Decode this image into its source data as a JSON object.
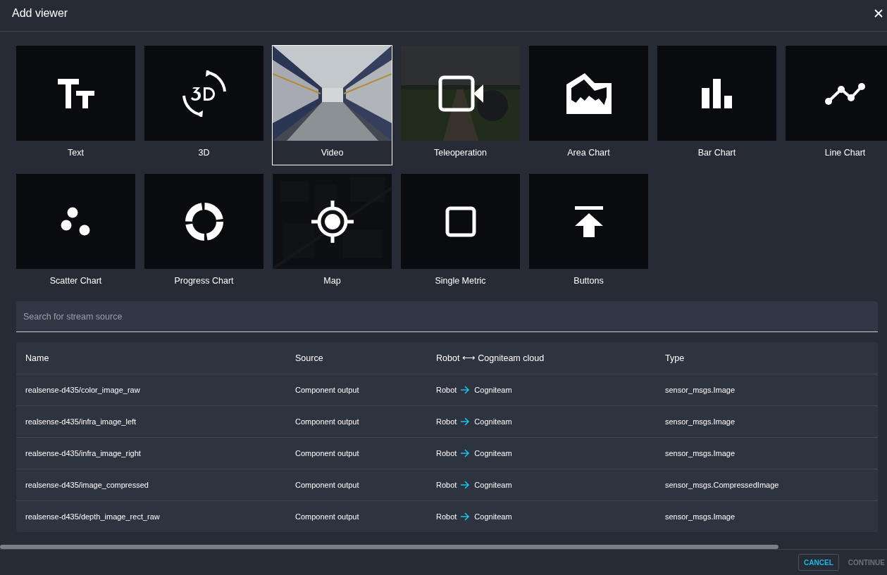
{
  "dialog": {
    "title": "Add viewer"
  },
  "viewers": [
    {
      "label": "Text",
      "kind": "text",
      "selected": false
    },
    {
      "label": "3D",
      "kind": "threed",
      "selected": false
    },
    {
      "label": "Video",
      "kind": "video",
      "selected": true
    },
    {
      "label": "Teleoperation",
      "kind": "teleoperation",
      "selected": false
    },
    {
      "label": "Area Chart",
      "kind": "area",
      "selected": false
    },
    {
      "label": "Bar Chart",
      "kind": "bar",
      "selected": false
    },
    {
      "label": "Line Chart",
      "kind": "line",
      "selected": false
    },
    {
      "label": "Scatter Chart",
      "kind": "scatter",
      "selected": false
    },
    {
      "label": "Progress Chart",
      "kind": "progress",
      "selected": false
    },
    {
      "label": "Map",
      "kind": "map",
      "selected": false
    },
    {
      "label": "Single Metric",
      "kind": "metric",
      "selected": false
    },
    {
      "label": "Buttons",
      "kind": "buttons",
      "selected": false
    }
  ],
  "search": {
    "placeholder": "Search for stream source"
  },
  "table": {
    "columns": [
      "Name",
      "Source",
      "Robot ⟷ Cogniteam cloud",
      "Type"
    ],
    "rows": [
      {
        "name": "realsense-d435/color_image_raw",
        "source": "Component output",
        "from": "Robot",
        "to": "Cogniteam",
        "type": "sensor_msgs.Image"
      },
      {
        "name": "realsense-d435/infra_image_left",
        "source": "Component output",
        "from": "Robot",
        "to": "Cogniteam",
        "type": "sensor_msgs.Image"
      },
      {
        "name": "realsense-d435/infra_image_right",
        "source": "Component output",
        "from": "Robot",
        "to": "Cogniteam",
        "type": "sensor_msgs.Image"
      },
      {
        "name": "realsense-d435/image_compressed",
        "source": "Component output",
        "from": "Robot",
        "to": "Cogniteam",
        "type": "sensor_msgs.CompressedImage"
      },
      {
        "name": "realsense-d435/depth_image_rect_raw",
        "source": "Component output",
        "from": "Robot",
        "to": "Cogniteam",
        "type": "sensor_msgs.Image"
      }
    ]
  },
  "buttons": [
    {
      "label": "CANCEL",
      "disabled": false
    },
    {
      "label": "CONTINUE",
      "disabled": true
    }
  ]
}
